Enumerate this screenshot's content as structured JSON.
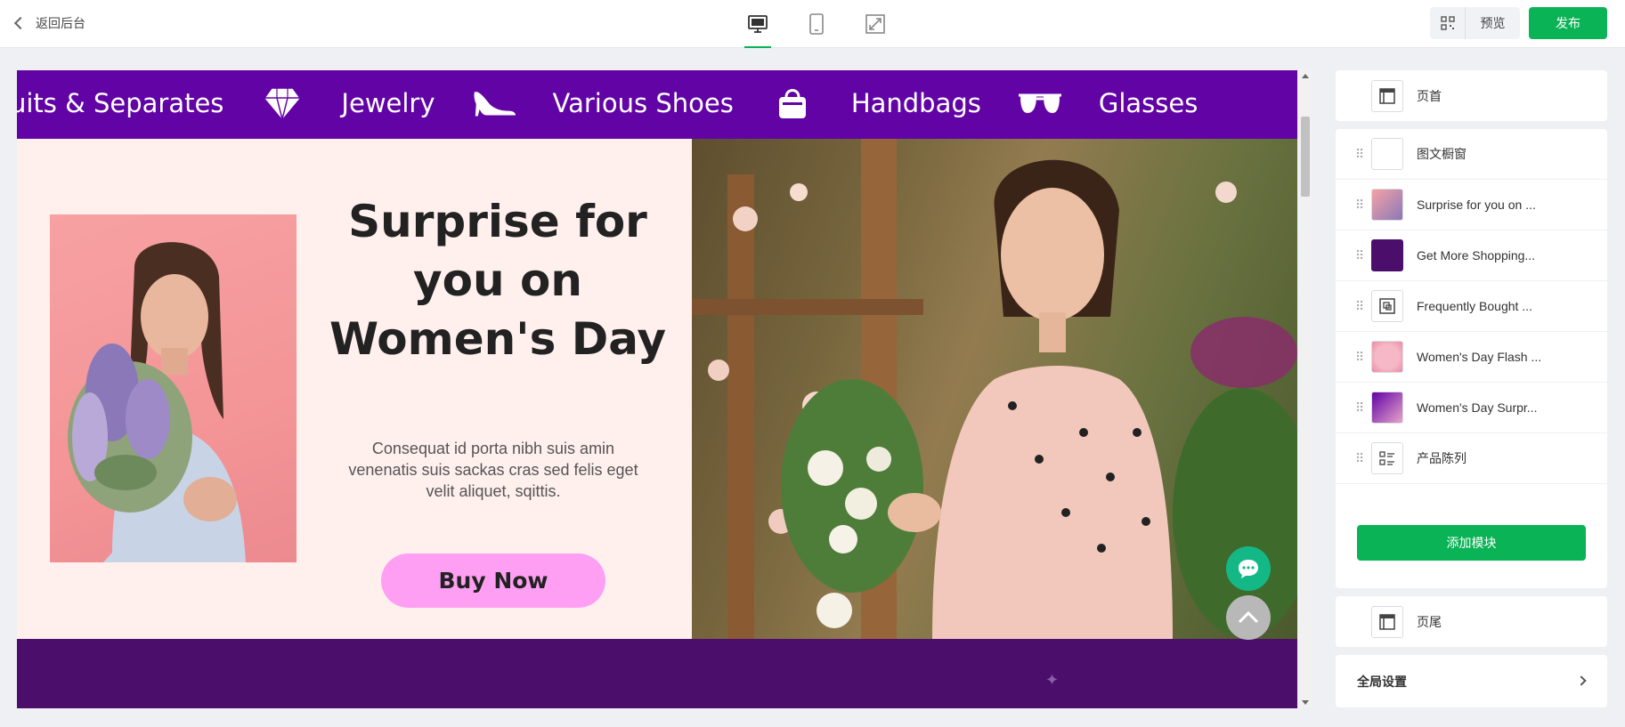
{
  "topbar": {
    "back_label": "返回后台",
    "devices": [
      "desktop-icon",
      "tablet-icon",
      "fullscreen-icon"
    ],
    "active_device": "desktop",
    "preview_label": "预览",
    "publish_label": "发布"
  },
  "canvas": {
    "marquee": {
      "items": [
        {
          "label": "uits & Separates"
        },
        {
          "icon": "diamond-icon"
        },
        {
          "label": "Jewelry"
        },
        {
          "icon": "high-heel-icon"
        },
        {
          "label": "Various Shoes"
        },
        {
          "icon": "handbag-icon"
        },
        {
          "label": "Handbags"
        },
        {
          "icon": "sunglasses-icon"
        },
        {
          "label": "Glasses"
        }
      ],
      "background": "#6203a6"
    },
    "hero": {
      "title": "Surprise for you on Women's Day",
      "title_lines": [
        "Surprise for",
        "you on",
        "Women's",
        "Day"
      ],
      "description": "Consequat id porta nibh suis amin venenatis suis sackas cras sed felis eget velit aliquet, sqittis.",
      "button_label": "Buy Now",
      "button_color": "#ff9ff3",
      "left_bg": "#fff0ee"
    },
    "band_color": "#4b0f6b"
  },
  "sidebar": {
    "header_label": "页首",
    "modules": [
      {
        "label": "图文橱窗",
        "thumb": "blank"
      },
      {
        "label": "Surprise for you on ...",
        "thumb": "photo-pink"
      },
      {
        "label": "Get More Shopping...",
        "thumb": "purple-swatch"
      },
      {
        "label": "Frequently Bought ...",
        "thumb": "products-icon"
      },
      {
        "label": "Women's Day Flash ...",
        "thumb": "photo-round"
      },
      {
        "label": "Women's Day Surpr...",
        "thumb": "photo-purple"
      },
      {
        "label": "产品陈列",
        "thumb": "list-icon"
      }
    ],
    "add_module_label": "添加模块",
    "footer_label": "页尾",
    "global_settings_label": "全局设置"
  },
  "colors": {
    "accent": "#0ab355",
    "purple": "#6203a6",
    "chat": "#14b886"
  }
}
